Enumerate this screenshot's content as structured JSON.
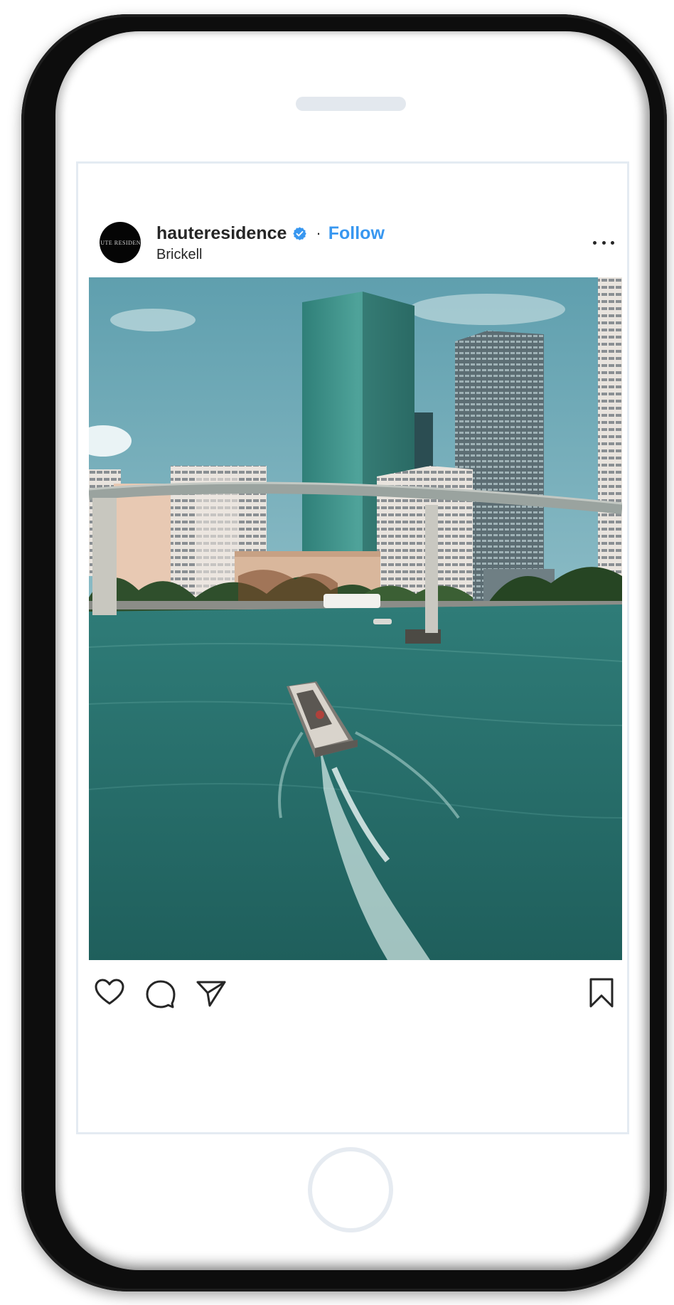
{
  "post": {
    "username": "hauteresidence",
    "verified": true,
    "separator": "·",
    "follow_label": "Follow",
    "location": "Brickell",
    "avatar_text": "HAUTE RESIDENCE",
    "photo": {
      "subject": "Miami River with skyscrapers, elevated metromover track and a speedboat"
    },
    "actions": {
      "like": "heart-icon",
      "comment": "comment-bubble-icon",
      "share": "paper-plane-icon",
      "save": "bookmark-icon",
      "more": "more-horizontal-icon"
    }
  },
  "colors": {
    "accent": "#3897f0",
    "text": "#262626",
    "card_border": "#e4ebf2",
    "phone_frame": "#0d0d0d"
  }
}
